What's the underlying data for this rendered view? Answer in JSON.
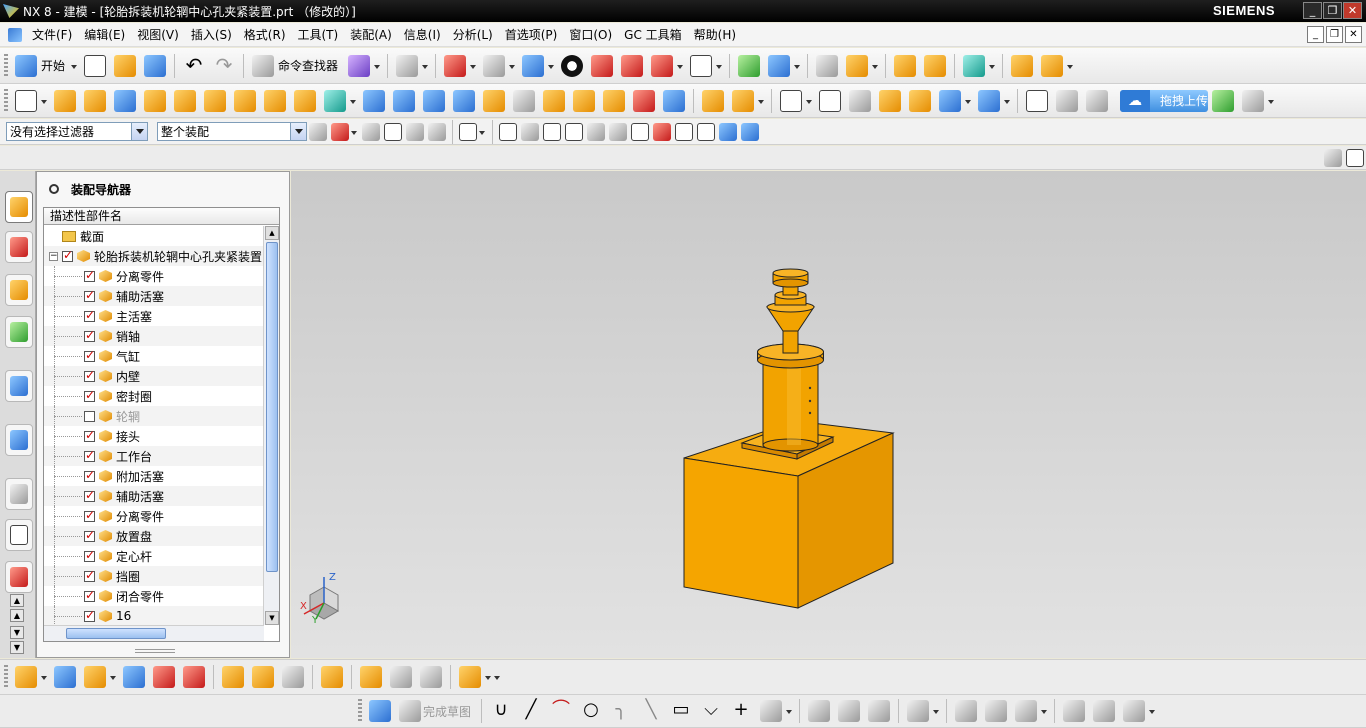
{
  "window": {
    "title": "NX 8 - 建模 - [轮胎拆装机轮辋中心孔夹紧装置.prt （修改的）]",
    "brand": "SIEMENS",
    "controls": [
      "_",
      "❐",
      "✕"
    ]
  },
  "menu": {
    "items": [
      "文件(F)",
      "编辑(E)",
      "视图(V)",
      "插入(S)",
      "格式(R)",
      "工具(T)",
      "装配(A)",
      "信息(I)",
      "分析(L)",
      "首选项(P)",
      "窗口(O)",
      "GC 工具箱",
      "帮助(H)"
    ]
  },
  "toolbar1": {
    "start_label": "开始",
    "command_finder_label": "命令查找器"
  },
  "toolbar2": {
    "upload_label": "拖拽上传"
  },
  "selection_bar": {
    "filter_value": "没有选择过滤器",
    "scope_value": "整个装配"
  },
  "navigator": {
    "title": "装配导航器",
    "column_header": "描述性部件名",
    "section_row": "截面",
    "root_part": "轮胎拆装机轮辋中心孔夹紧装置",
    "parts": [
      {
        "name": "分离零件",
        "checked": true
      },
      {
        "name": "辅助活塞",
        "checked": true
      },
      {
        "name": "主活塞",
        "checked": true
      },
      {
        "name": "销轴",
        "checked": true
      },
      {
        "name": "气缸",
        "checked": true
      },
      {
        "name": "内壁",
        "checked": true
      },
      {
        "name": "密封圈",
        "checked": true
      },
      {
        "name": "轮辋",
        "checked": false
      },
      {
        "name": "接头",
        "checked": true
      },
      {
        "name": "工作台",
        "checked": true
      },
      {
        "name": "附加活塞",
        "checked": true
      },
      {
        "name": "辅助活塞",
        "checked": true
      },
      {
        "name": "分离零件",
        "checked": true
      },
      {
        "name": "放置盘",
        "checked": true
      },
      {
        "name": "定心杆",
        "checked": true
      },
      {
        "name": "挡圈",
        "checked": true
      },
      {
        "name": "闭合零件",
        "checked": true
      },
      {
        "name": "16",
        "checked": true
      }
    ]
  },
  "triad": {
    "x": "X",
    "y": "Y",
    "z": "Z"
  },
  "sketch_toolbar": {
    "finish_label": "完成草图"
  },
  "colors": {
    "model": "#f5a500",
    "model_dark": "#c77d00",
    "background_top": "#c9c9c9",
    "background_bottom": "#e2e2e2"
  }
}
